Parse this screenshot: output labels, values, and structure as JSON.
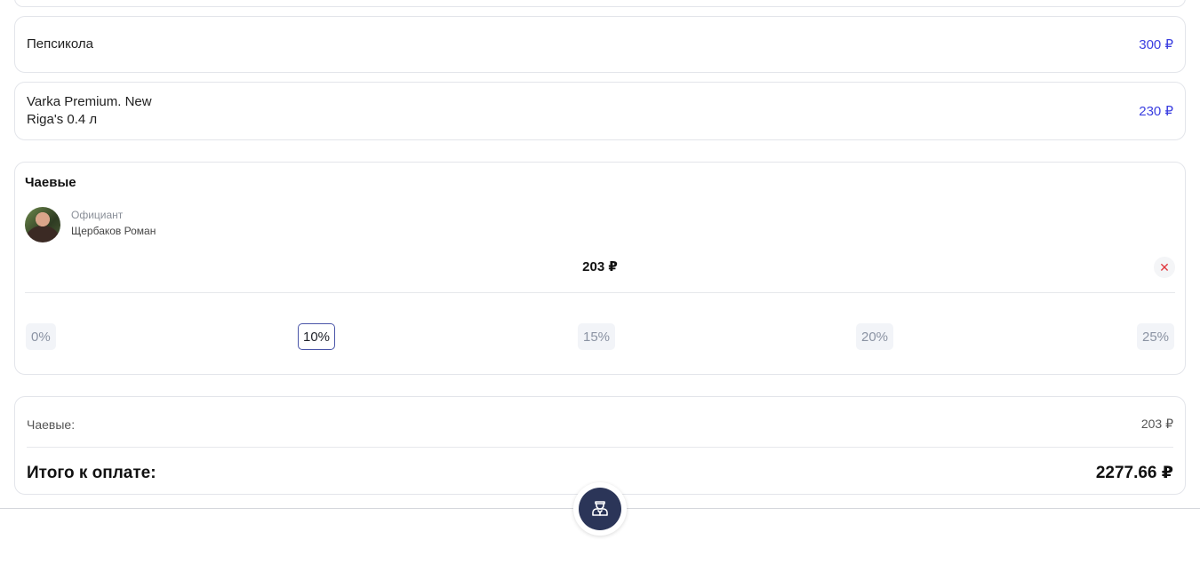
{
  "order_items": [
    {
      "name": "Пепсикола",
      "price": "300 ₽"
    },
    {
      "name": "Varka Premium. New Riga's 0.4 л",
      "price": "230 ₽"
    }
  ],
  "tips": {
    "title": "Чаевые",
    "waiter_role": "Официант",
    "waiter_name": "Щербаков Роман",
    "amount": "203 ₽",
    "remove_icon": "close-icon",
    "percent_options": [
      "0%",
      "10%",
      "15%",
      "20%",
      "25%"
    ],
    "selected_percent": "10%"
  },
  "summary": {
    "tips_label": "Чаевые:",
    "tips_value": "203 ₽",
    "total_label": "Итого к оплате:",
    "total_value": "2277.66 ₽"
  },
  "call_waiter_icon": "waiter-icon",
  "colors": {
    "accent_price": "#3a3ee0",
    "selected_border": "#4a55a8",
    "call_button": "#2b3558",
    "remove": "#e0383e"
  }
}
